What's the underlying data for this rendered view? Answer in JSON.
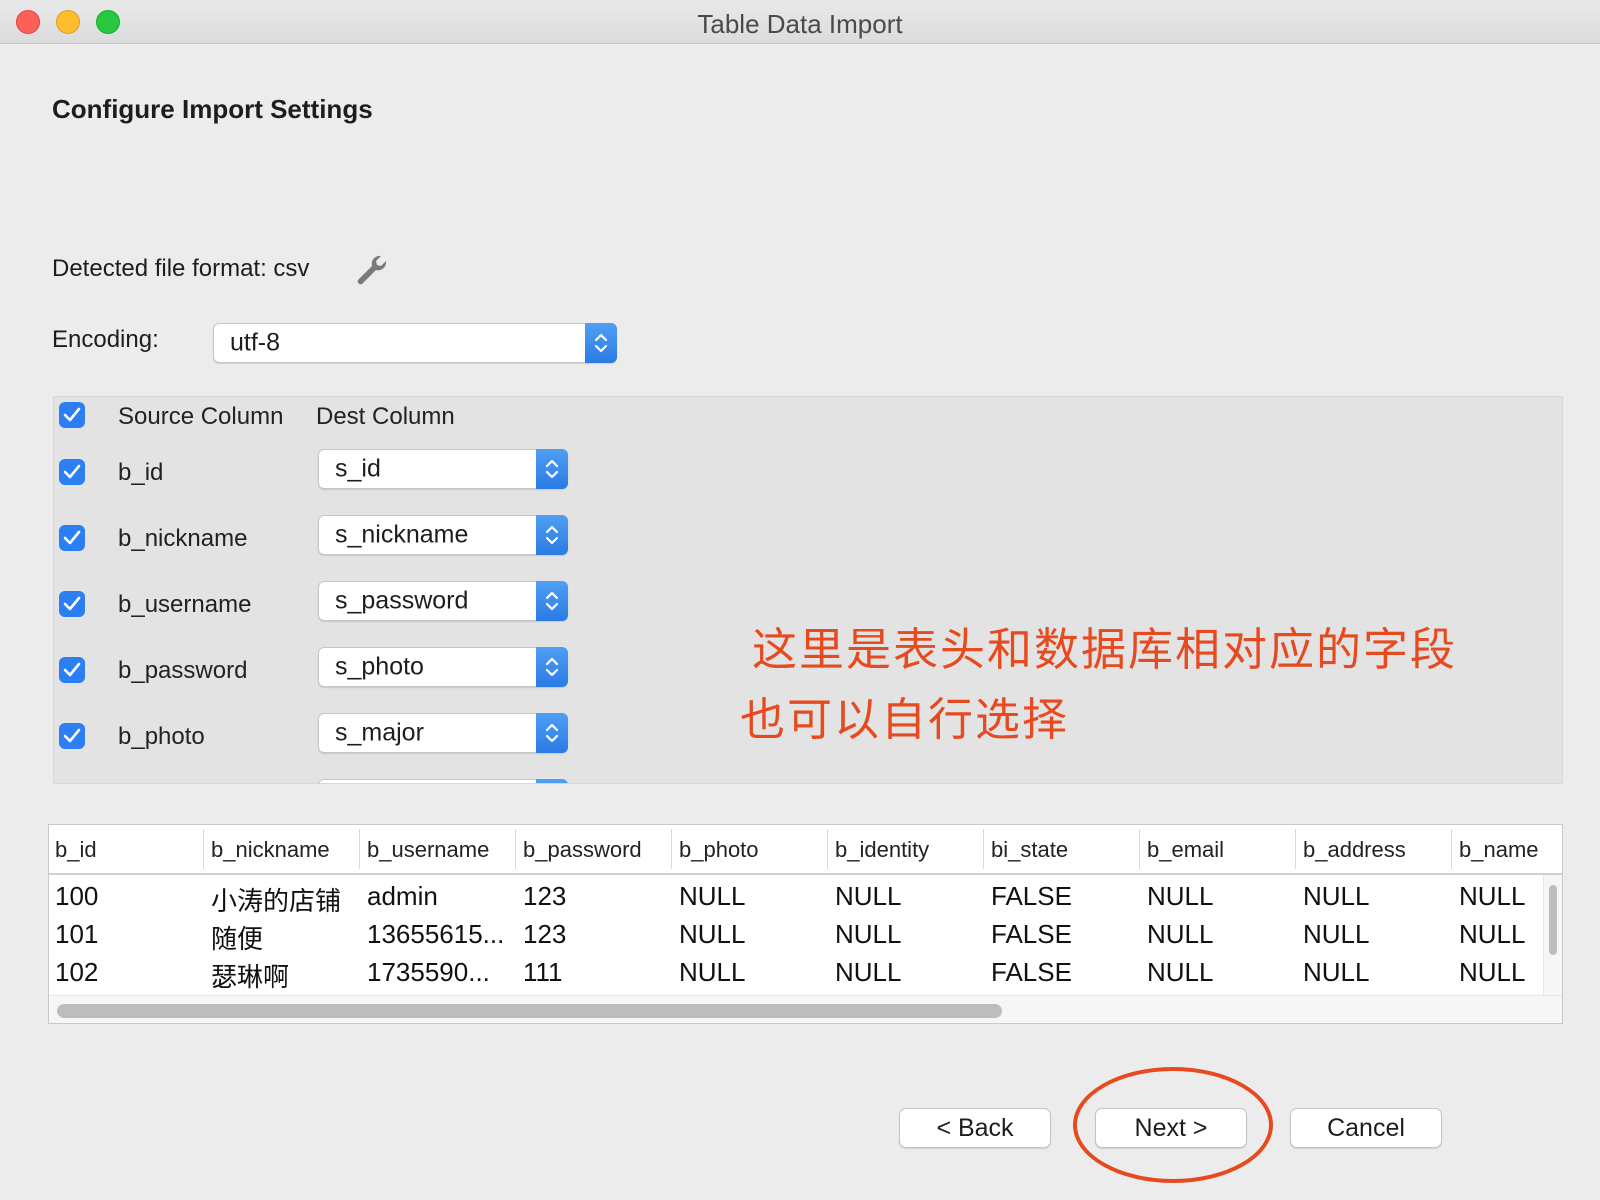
{
  "window": {
    "title": "Table Data Import"
  },
  "page": {
    "heading": "Configure Import Settings"
  },
  "format": {
    "label": "Detected file format: csv",
    "icon": "wrench-icon"
  },
  "encoding": {
    "label": "Encoding:",
    "value": "utf-8"
  },
  "mapping": {
    "select_all_checked": true,
    "header_source": "Source Column",
    "header_dest": "Dest Column",
    "rows": [
      {
        "source": "b_id",
        "dest": "s_id",
        "checked": true
      },
      {
        "source": "b_nickname",
        "dest": "s_nickname",
        "checked": true
      },
      {
        "source": "b_username",
        "dest": "s_password",
        "checked": true
      },
      {
        "source": "b_password",
        "dest": "s_photo",
        "checked": true
      },
      {
        "source": "b_photo",
        "dest": "s_major",
        "checked": true
      }
    ]
  },
  "annotation": {
    "line1": "这里是表头和数据库相对应的字段",
    "line2": "也可以自行选择",
    "color": "#e64a1e"
  },
  "preview": {
    "columns": [
      "b_id",
      "b_nickname",
      "b_username",
      "b_password",
      "b_photo",
      "b_identity",
      "bi_state",
      "b_email",
      "b_address",
      "b_name"
    ],
    "rows": [
      [
        "100",
        "小涛的店铺",
        "admin",
        "123",
        "NULL",
        "NULL",
        "FALSE",
        "NULL",
        "NULL",
        "NULL"
      ],
      [
        "101",
        "随便",
        "13655615...",
        "123",
        "NULL",
        "NULL",
        "FALSE",
        "NULL",
        "NULL",
        "NULL"
      ],
      [
        "102",
        "瑟琳啊",
        "1735590...",
        "111",
        "NULL",
        "NULL",
        "FALSE",
        "NULL",
        "NULL",
        "NULL"
      ]
    ]
  },
  "buttons": {
    "back": "< Back",
    "next": "Next >",
    "cancel": "Cancel"
  },
  "colors": {
    "accent": "#2b7ff2",
    "annotation": "#e64a1e"
  }
}
